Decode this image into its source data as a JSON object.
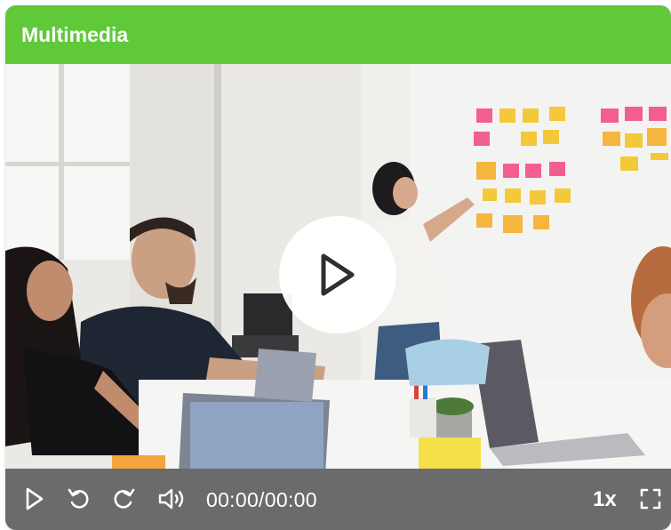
{
  "header": {
    "title": "Multimedia"
  },
  "player": {
    "time_display": "00:00/00:00",
    "speed_label": "1x"
  },
  "colors": {
    "header_bg": "#5fc93a",
    "controls_bg": "#6b6b6b",
    "icon_color": "#ffffff"
  },
  "icons": [
    "play-icon",
    "replay-icon",
    "forward-icon",
    "volume-icon",
    "fullscreen-icon",
    "big-play-icon"
  ]
}
